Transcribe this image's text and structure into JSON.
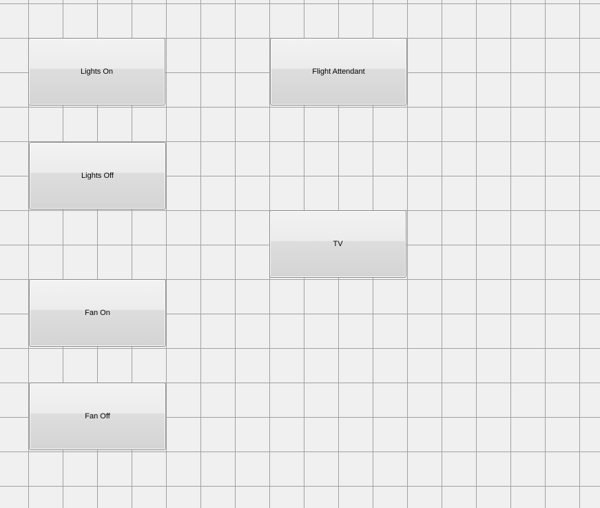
{
  "canvas": {
    "background_color": "#f0f0f0",
    "grid_line_color": "#a0a0a0"
  },
  "buttons": {
    "lights_on": "Lights On",
    "lights_off": "Lights Off",
    "fan_on": "Fan On",
    "fan_off": "Fan Off",
    "flight_attendant": "Flight Attendant",
    "tv": "TV"
  }
}
